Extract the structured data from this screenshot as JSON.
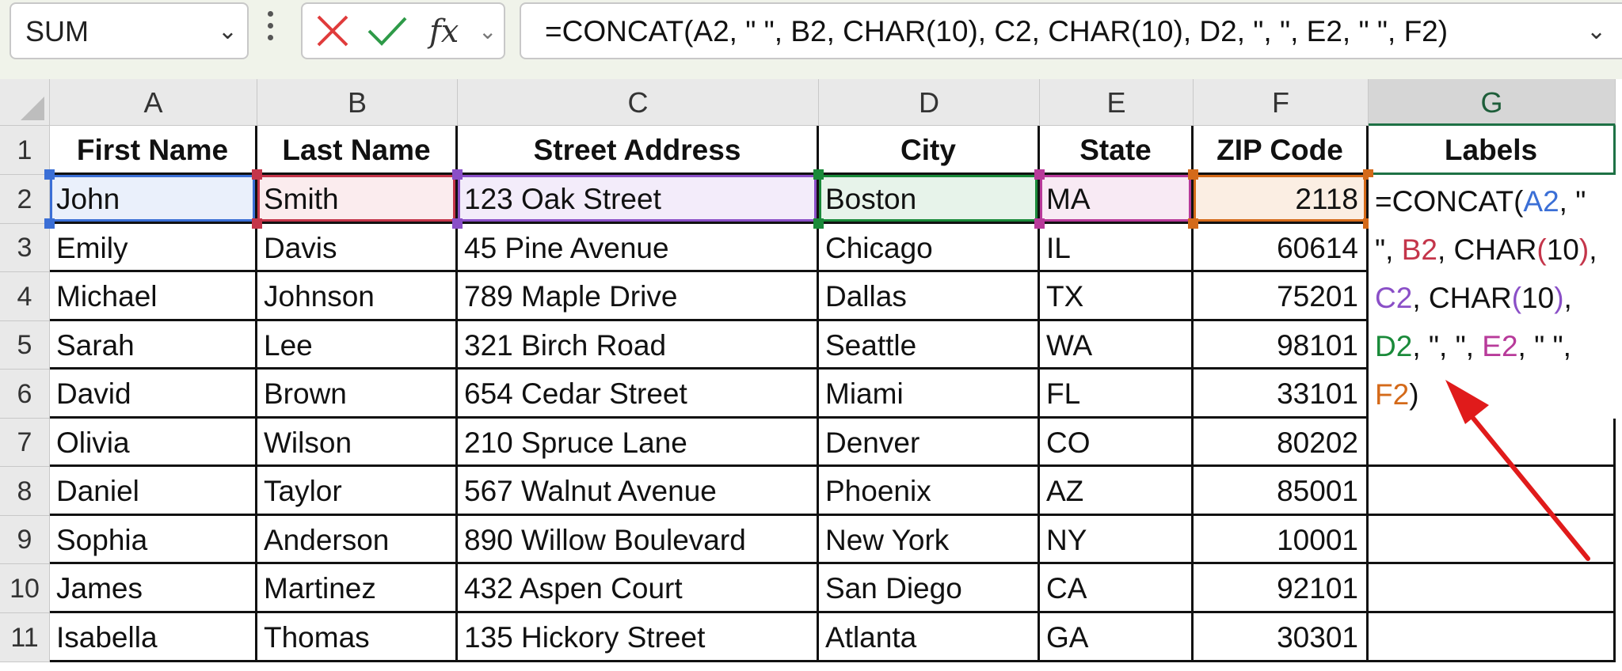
{
  "name_box": {
    "value": "SUM"
  },
  "formula_bar": {
    "fx_label": "fx",
    "formula": "=CONCAT(A2, \" \", B2, CHAR(10), C2, CHAR(10), D2, \", \", E2, \" \", F2)"
  },
  "columns": [
    "A",
    "B",
    "C",
    "D",
    "E",
    "F",
    "G"
  ],
  "rows": [
    "1",
    "2",
    "3",
    "4",
    "5",
    "6",
    "7",
    "8",
    "9",
    "10",
    "11"
  ],
  "headers": [
    "First Name",
    "Last Name",
    "Street Address",
    "City",
    "State",
    "ZIP Code",
    "Labels"
  ],
  "table": [
    [
      "John",
      "Smith",
      "123 Oak Street",
      "Boston",
      "MA",
      "2118"
    ],
    [
      "Emily",
      "Davis",
      "45 Pine Avenue",
      "Chicago",
      "IL",
      "60614"
    ],
    [
      "Michael",
      "Johnson",
      "789 Maple Drive",
      "Dallas",
      "TX",
      "75201"
    ],
    [
      "Sarah",
      "Lee",
      "321 Birch Road",
      "Seattle",
      "WA",
      "98101"
    ],
    [
      "David",
      "Brown",
      "654 Cedar Street",
      "Miami",
      "FL",
      "33101"
    ],
    [
      "Olivia",
      "Wilson",
      "210 Spruce Lane",
      "Denver",
      "CO",
      "80202"
    ],
    [
      "Daniel",
      "Taylor",
      "567 Walnut Avenue",
      "Phoenix",
      "AZ",
      "85001"
    ],
    [
      "Sophia",
      "Anderson",
      "890 Willow Boulevard",
      "New York",
      "NY",
      "10001"
    ],
    [
      "James",
      "Martinez",
      "432 Aspen Court",
      "San Diego",
      "CA",
      "92101"
    ],
    [
      "Isabella",
      "Thomas",
      "135 Hickory Street",
      "Atlanta",
      "GA",
      "30301"
    ]
  ],
  "cell_edit": {
    "lines": [
      [
        {
          "t": "=CONCAT(",
          "c": "#111"
        },
        {
          "t": "A2",
          "c": "#3b6fd6"
        },
        {
          "t": ", \"",
          "c": "#111"
        }
      ],
      [
        {
          "t": "\", ",
          "c": "#111"
        },
        {
          "t": "B2",
          "c": "#c4354a"
        },
        {
          "t": ", CHAR",
          "c": "#111"
        },
        {
          "t": "(",
          "c": "#c4354a"
        },
        {
          "t": "10",
          "c": "#111"
        },
        {
          "t": ")",
          "c": "#c4354a"
        },
        {
          "t": ",",
          "c": "#111"
        }
      ],
      [
        {
          "t": "C2",
          "c": "#8a4fc7"
        },
        {
          "t": ", CHAR",
          "c": "#111"
        },
        {
          "t": "(",
          "c": "#8a4fc7"
        },
        {
          "t": "10",
          "c": "#111"
        },
        {
          "t": ")",
          "c": "#8a4fc7"
        },
        {
          "t": ",",
          "c": "#111"
        }
      ],
      [
        {
          "t": "D2",
          "c": "#1a8a3a"
        },
        {
          "t": ", \", \", ",
          "c": "#111"
        },
        {
          "t": "E2",
          "c": "#b83a9a"
        },
        {
          "t": ", \" \",",
          "c": "#111"
        }
      ],
      [
        {
          "t": "F2",
          "c": "#d46a1a"
        },
        {
          "t": ")",
          "c": "#111"
        }
      ]
    ]
  },
  "ref_colors": {
    "A": "#3b6fd6",
    "B": "#c4354a",
    "C": "#8a4fc7",
    "D": "#1a8a3a",
    "E": "#b83a9a",
    "F": "#d46a1a"
  },
  "ref_fills": {
    "A": "#eaf0fb",
    "B": "#fbecee",
    "C": "#f3ecfa",
    "D": "#e7f3ea",
    "E": "#f8eaf4",
    "F": "#fbeee3"
  },
  "icons": {
    "cancel": "x-icon",
    "enter": "check-icon",
    "fx": "function-icon"
  },
  "accent_color": "#1e7145",
  "annotation_color": "#e01b1b"
}
